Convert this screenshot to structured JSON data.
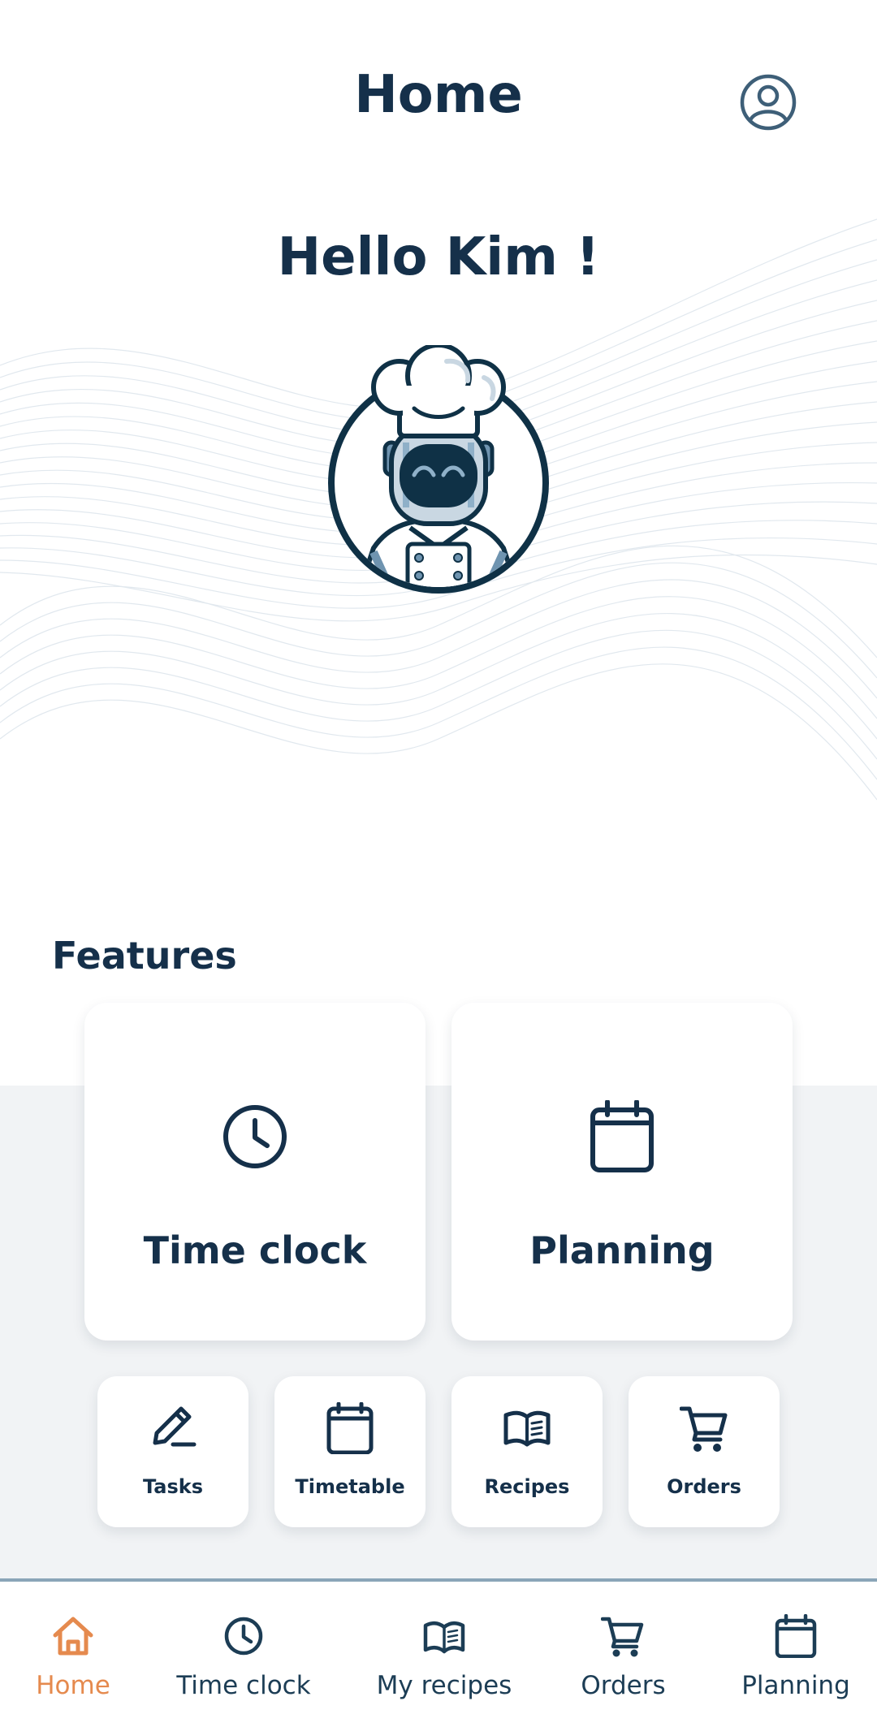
{
  "header": {
    "title": "Home",
    "profile_icon": "account-circle-icon"
  },
  "hero": {
    "greeting": "Hello Kim !",
    "avatar": "robot-chef-avatar"
  },
  "features": {
    "title": "Features",
    "large_cards": [
      {
        "label": "Time clock",
        "icon": "clock-icon"
      },
      {
        "label": "Planning",
        "icon": "calendar-icon"
      }
    ],
    "small_cards": [
      {
        "label": "Tasks",
        "icon": "pencil-icon"
      },
      {
        "label": "Timetable",
        "icon": "calendar-icon"
      },
      {
        "label": "Recipes",
        "icon": "book-icon"
      },
      {
        "label": "Orders",
        "icon": "cart-icon"
      }
    ]
  },
  "bottom_nav": {
    "items": [
      {
        "label": "Home",
        "icon": "home-icon",
        "active": true
      },
      {
        "label": "Time clock",
        "icon": "clock-icon",
        "active": false
      },
      {
        "label": "My recipes",
        "icon": "book-icon",
        "active": false
      },
      {
        "label": "Orders",
        "icon": "cart-icon",
        "active": false
      },
      {
        "label": "Planning",
        "icon": "calendar-icon",
        "active": false
      }
    ]
  },
  "colors": {
    "primary": "#15304a",
    "accent": "#e58a4e",
    "highlight": "#f1a56b",
    "surface": "#f1f3f5",
    "nav_border": "#8aa5b8"
  }
}
